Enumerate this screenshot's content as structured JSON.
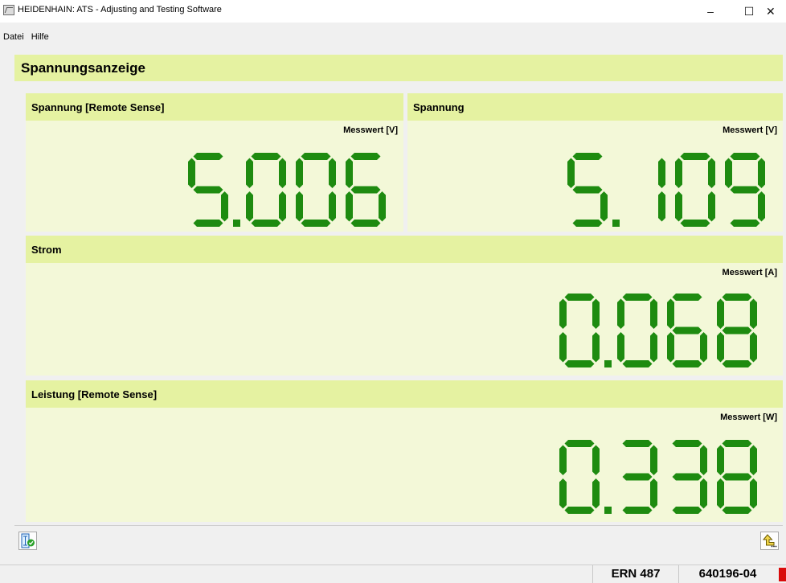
{
  "window": {
    "title": "HEIDENHAIN: ATS - Adjusting and Testing Software",
    "minimize_glyph": "–",
    "maximize_glyph": "☐",
    "close_glyph": "✕"
  },
  "menu": [
    "Datei",
    "Hilfe"
  ],
  "page": {
    "title": "Spannungsanzeige"
  },
  "panels": [
    {
      "title": "Spannung [Remote Sense]",
      "unit_label": "Messwert [V]",
      "value": "5.006"
    },
    {
      "title": "Spannung",
      "unit_label": "Messwert [V]",
      "value": "5.109"
    },
    {
      "title": "Strom",
      "unit_label": "Messwert [A]",
      "value": "0.068"
    },
    {
      "title": "Leistung [Remote Sense]",
      "unit_label": "Messwert [W]",
      "value": "0.338"
    }
  ],
  "toolbar": {
    "left_icon": "measurement-check-icon",
    "right_icon": "return-arrow-icon"
  },
  "status": {
    "device": "ERN 487",
    "id": "640196-04",
    "indicator_color": "#d90b0b"
  },
  "colors": {
    "header_bg": "#e5f2a1",
    "panel_bg": "#f3f8d8",
    "digit": "#1e8b10"
  }
}
